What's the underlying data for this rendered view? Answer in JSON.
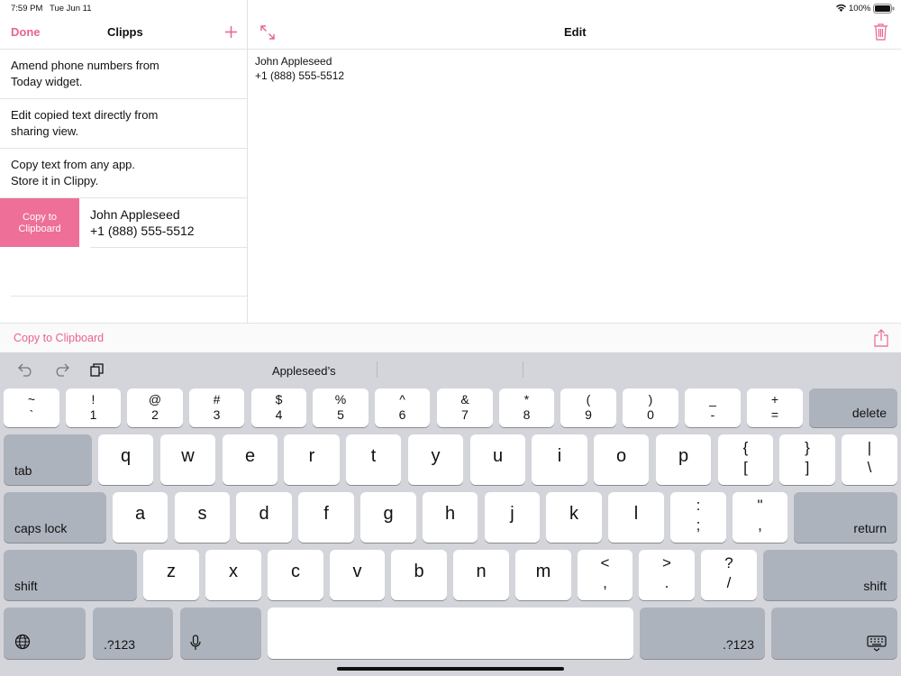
{
  "status": {
    "time": "7:59 PM",
    "date": "Tue Jun 11",
    "battery": "100%"
  },
  "left": {
    "done_label": "Done",
    "title": "Clipps",
    "clips": [
      {
        "line1": "Amend phone numbers from",
        "line2": "Today widget."
      },
      {
        "line1": "Edit copied text directly from",
        "line2": "sharing view."
      },
      {
        "line1": "Copy text from any app.",
        "line2": "Store it in Clippy."
      },
      {
        "line1": "John Appleseed",
        "line2": "+1 (888) 555-5512"
      }
    ],
    "swipe_action_line1": "Copy to",
    "swipe_action_line2": "Clipboard"
  },
  "right": {
    "title": "Edit",
    "text_line1": "John Appleseed",
    "text_line2": "+1 (888) 555-5512"
  },
  "toolbar": {
    "copy_label": "Copy to Clipboard"
  },
  "keyboard": {
    "suggestion": "Appleseed’s",
    "num_row": [
      [
        "~",
        "`"
      ],
      [
        "!",
        "1"
      ],
      [
        "@",
        "2"
      ],
      [
        "#",
        "3"
      ],
      [
        "$",
        "4"
      ],
      [
        "%",
        "5"
      ],
      [
        "^",
        "6"
      ],
      [
        "&",
        "7"
      ],
      [
        "*",
        "8"
      ],
      [
        "(",
        "9"
      ],
      [
        ")",
        "0"
      ],
      [
        "_",
        "-"
      ],
      [
        "+",
        "="
      ]
    ],
    "delete": "delete",
    "tab": "tab",
    "row_q": [
      "q",
      "w",
      "e",
      "r",
      "t",
      "y",
      "u",
      "i",
      "o",
      "p"
    ],
    "row_q_sym": [
      [
        "{",
        "["
      ],
      [
        "}",
        "]"
      ],
      [
        "|",
        "\\"
      ]
    ],
    "caps": "caps lock",
    "row_a": [
      "a",
      "s",
      "d",
      "f",
      "g",
      "h",
      "j",
      "k",
      "l"
    ],
    "row_a_sym": [
      [
        ":",
        ";"
      ],
      [
        "\"",
        ","
      ]
    ],
    "return": "return",
    "shift": "shift",
    "row_z": [
      "z",
      "x",
      "c",
      "v",
      "b",
      "n",
      "m"
    ],
    "row_z_sym": [
      [
        "<",
        ","
      ],
      [
        ">",
        "."
      ],
      [
        "?",
        "/"
      ]
    ],
    "num_switch": ".?123"
  }
}
